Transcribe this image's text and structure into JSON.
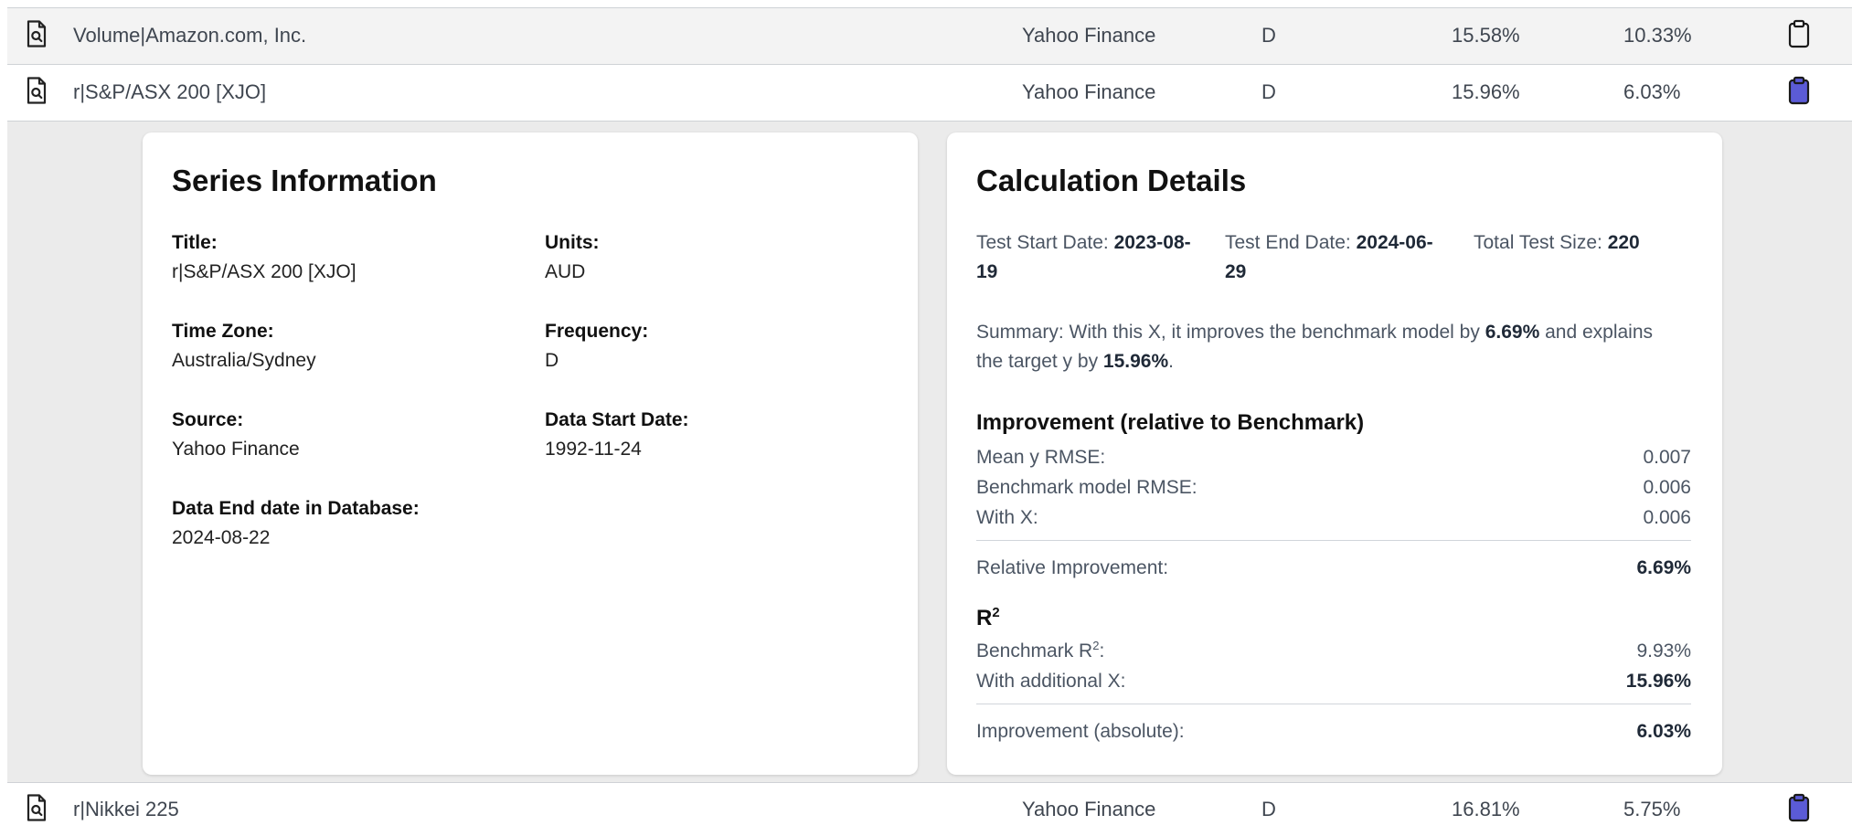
{
  "rows": [
    {
      "title": "Volume|Amazon.com, Inc.",
      "source": "Yahoo Finance",
      "frequency": "D",
      "r2": "15.58%",
      "improvement": "10.33%",
      "clipboard_filled": false
    },
    {
      "title": "r|S&P/ASX 200 [XJO]",
      "source": "Yahoo Finance",
      "frequency": "D",
      "r2": "15.96%",
      "improvement": "6.03%",
      "clipboard_filled": true
    },
    {
      "title": "r|Nikkei 225",
      "source": "Yahoo Finance",
      "frequency": "D",
      "r2": "16.81%",
      "improvement": "5.75%",
      "clipboard_filled": true
    }
  ],
  "series_info": {
    "heading": "Series Information",
    "title_label": "Title:",
    "title_value": "r|S&P/ASX 200 [XJO]",
    "units_label": "Units:",
    "units_value": "AUD",
    "timezone_label": "Time Zone:",
    "timezone_value": "Australia/Sydney",
    "frequency_label": "Frequency:",
    "frequency_value": "D",
    "source_label": "Source:",
    "source_value": "Yahoo Finance",
    "start_label": "Data Start Date:",
    "start_value": "1992-11-24",
    "end_label": "Data End date in Database:",
    "end_value": "2024-08-22"
  },
  "calc": {
    "heading": "Calculation Details",
    "test_start_label": "Test Start Date:",
    "test_start_value_a": "2023-08-",
    "test_start_value_b": "19",
    "test_end_label": "Test End Date:",
    "test_end_value_a": "2024-06-",
    "test_end_value_b": "29",
    "test_size_label": "Total Test Size:",
    "test_size_value": "220",
    "summary_p1": "Summary: With this X, it improves the benchmark model by",
    "summary_v1": "6.69%",
    "summary_p2": "and explains",
    "summary_p3": "the target y by",
    "summary_v2": "15.96%",
    "summary_end": ".",
    "improvement_heading": "Improvement (relative to Benchmark)",
    "mean_rmse_label": "Mean y RMSE:",
    "mean_rmse_value": "0.007",
    "bench_rmse_label": "Benchmark model RMSE:",
    "bench_rmse_value": "0.006",
    "withx_label": "With X:",
    "withx_value": "0.006",
    "rel_impr_label": "Relative Improvement:",
    "rel_impr_value": "6.69%",
    "r2_heading": "R",
    "r2_sup": "2",
    "bench_r2_label": "Benchmark R",
    "bench_r2_colon": ":",
    "bench_r2_value": "9.93%",
    "add_x_label": "With additional X:",
    "add_x_value": "15.96%",
    "abs_impr_label": "Improvement (absolute):",
    "abs_impr_value": "6.03%"
  },
  "colors": {
    "clipboard_fill": "#5b5bd6",
    "clipboard_outline": "#1a1a1a"
  }
}
